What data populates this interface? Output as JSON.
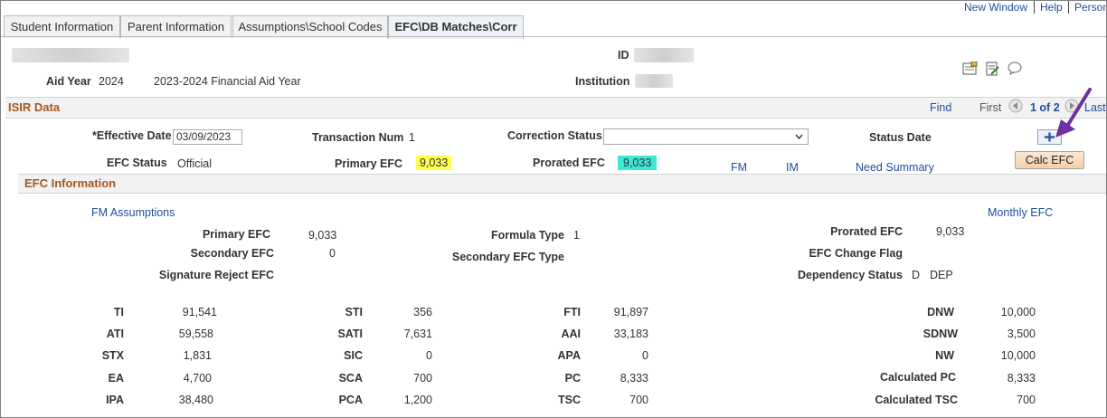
{
  "tabs": [
    {
      "label": "Student Information"
    },
    {
      "label": "Parent Information"
    },
    {
      "label": "Assumptions\\School Codes"
    },
    {
      "label": "EFC\\DB Matches\\Corr"
    }
  ],
  "top_links": {
    "new_window": "New Window",
    "help": "Help",
    "personalize": "Person"
  },
  "header": {
    "aid_year_label": "Aid Year",
    "aid_year_value": "2024",
    "aid_year_desc": "2023-2024 Financial Aid Year",
    "id_label": "ID",
    "institution_label": "Institution"
  },
  "isir": {
    "title": "ISIR Data",
    "find": "Find",
    "first": "First",
    "page": "1 of 2",
    "last": "Last",
    "effective_date_label": "*Effective Date",
    "effective_date_value": "03/09/2023",
    "transaction_num_label": "Transaction Num",
    "transaction_num_value": "1",
    "correction_status_label": "Correction Status",
    "correction_status_value": "",
    "status_date_label": "Status Date",
    "efc_status_label": "EFC Status",
    "efc_status_value": "Official",
    "primary_efc_label": "Primary EFC",
    "primary_efc_value": "9,033",
    "prorated_efc_label": "Prorated EFC",
    "prorated_efc_value": "9,033",
    "fm_link": "FM",
    "im_link": "IM",
    "need_summary_link": "Need Summary",
    "calc_efc_button": "Calc EFC"
  },
  "efc_info": {
    "title": "EFC Information",
    "fm_assumptions_link": "FM Assumptions",
    "monthly_efc_link": "Monthly EFC",
    "primary_efc_label": "Primary EFC",
    "primary_efc_value": "9,033",
    "secondary_efc_label": "Secondary EFC",
    "secondary_efc_value": "0",
    "signature_reject_label": "Signature Reject EFC",
    "formula_type_label": "Formula Type",
    "formula_type_value": "1",
    "secondary_efc_type_label": "Secondary EFC Type",
    "prorated_efc_label": "Prorated EFC",
    "prorated_efc_value": "9,033",
    "efc_change_flag_label": "EFC Change Flag",
    "dependency_status_label": "Dependency Status",
    "dependency_status_code": "D",
    "dependency_status_desc": "DEP"
  },
  "grid": {
    "col1": [
      {
        "label": "TI",
        "value": "91,541"
      },
      {
        "label": "ATI",
        "value": "59,558"
      },
      {
        "label": "STX",
        "value": "1,831"
      },
      {
        "label": "EA",
        "value": "4,700"
      },
      {
        "label": "IPA",
        "value": "38,480"
      }
    ],
    "col2": [
      {
        "label": "STI",
        "value": "356"
      },
      {
        "label": "SATI",
        "value": "7,631"
      },
      {
        "label": "SIC",
        "value": "0"
      },
      {
        "label": "SCA",
        "value": "700"
      },
      {
        "label": "PCA",
        "value": "1,200"
      }
    ],
    "col3": [
      {
        "label": "FTI",
        "value": "91,897"
      },
      {
        "label": "AAI",
        "value": "33,183"
      },
      {
        "label": "APA",
        "value": "0"
      },
      {
        "label": "PC",
        "value": "8,333"
      },
      {
        "label": "TSC",
        "value": "700"
      }
    ],
    "col4": [
      {
        "label": "DNW",
        "value": "10,000"
      },
      {
        "label": "SDNW",
        "value": "3,500"
      },
      {
        "label": "NW",
        "value": "10,000"
      },
      {
        "label": "Calculated PC",
        "value": "8,333"
      },
      {
        "label": "Calculated TSC",
        "value": "700"
      }
    ]
  },
  "colors": {
    "section_header": "#a4561c",
    "link": "#1f4e9c",
    "highlight_yellow": "#ffff4d",
    "highlight_cyan": "#3de8d5",
    "annotation_arrow": "#7030a0"
  }
}
